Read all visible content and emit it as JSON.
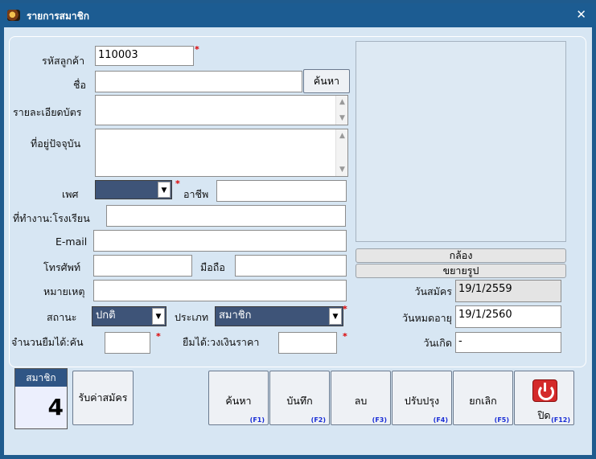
{
  "window": {
    "title": "รายการสมาชิก",
    "close_glyph": "✕"
  },
  "form": {
    "customer_id_label": "รหัสลูกค้า",
    "customer_id_value": "110003",
    "name_label": "ชื่อ",
    "name_value": "",
    "search_label": "ค้นหา",
    "card_details_label": "รายละเอียดบัตร",
    "address_label": "ที่อยู่ปัจจุบัน",
    "gender_label": "เพศ",
    "gender_value": "",
    "occupation_label": "อาชีพ",
    "workplace_label": "ที่ทำงาน:โรงเรียน",
    "email_label": "E-mail",
    "phone_label": "โทรศัพท์",
    "mobile_label": "มือถือ",
    "note_label": "หมายเหตุ",
    "status_label": "สถานะ",
    "status_value": "ปกติ",
    "type_label": "ประเภท",
    "type_value": "สมาชิก",
    "borrow_count_label": "จำนวนยืมได้:คัน",
    "borrow_amount_label": "ยืมได้:วงเงินราคา"
  },
  "photo": {
    "camera_label": "กล้อง",
    "enlarge_label": "ขยายรูป"
  },
  "dates": {
    "apply_label": "วันสมัคร",
    "apply_value": "19/1/2559",
    "expire_label": "วันหมดอายุ",
    "expire_value": "19/1/2560",
    "birth_label": "วันเกิด",
    "birth_value": "-"
  },
  "member_count": {
    "label": "สมาชิก",
    "value": "4"
  },
  "fee_button": "รับค่าสมัคร",
  "actions": [
    {
      "label": "ค้นหา",
      "key": "(F1)"
    },
    {
      "label": "บันทึก",
      "key": "(F2)"
    },
    {
      "label": "ลบ",
      "key": "(F3)"
    },
    {
      "label": "ปรับปรุง",
      "key": "(F4)"
    },
    {
      "label": "ยกเลิก",
      "key": "(F5)"
    },
    {
      "label": "ปิด",
      "key": "(F12)"
    }
  ],
  "colors": {
    "title_bar": "#1c5c92",
    "client": "#d7e6f3",
    "combo": "#3e5478",
    "required": "#dd0000",
    "key_hint": "#1a2ed6"
  }
}
